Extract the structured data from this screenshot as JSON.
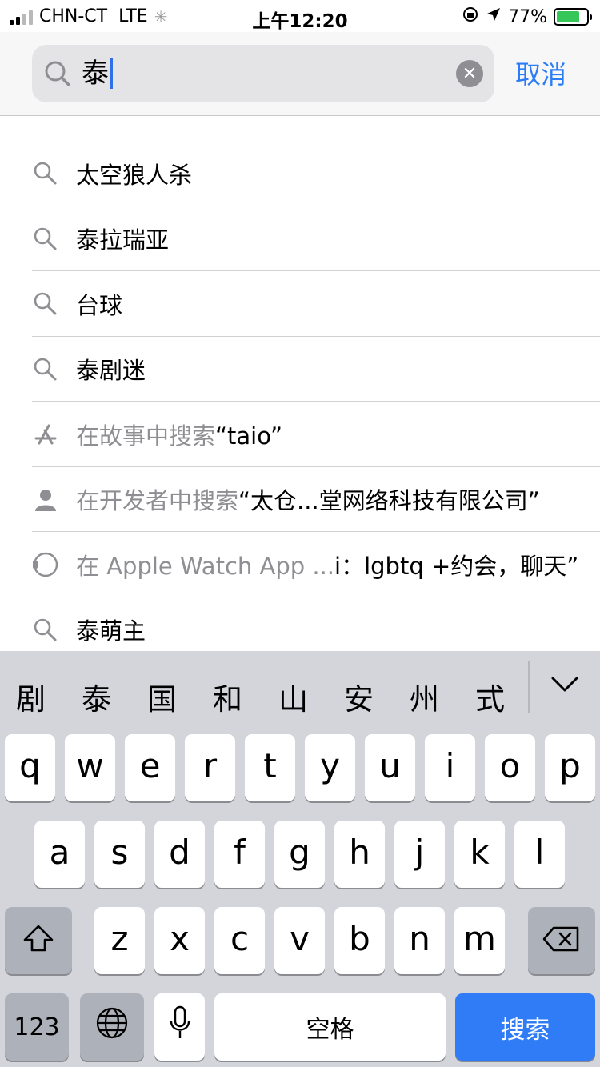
{
  "status_bar": {
    "carrier": "CHN-CT",
    "network": "LTE",
    "time": "上午12:20",
    "battery_percent": "77%",
    "battery_level": 0.77
  },
  "search": {
    "query": "泰",
    "cancel_label": "取消"
  },
  "suggestions": [
    {
      "type": "search",
      "icon": "search-icon",
      "prefix": "",
      "text": "太空狼人杀"
    },
    {
      "type": "search",
      "icon": "search-icon",
      "prefix": "",
      "text": "泰拉瑞亚"
    },
    {
      "type": "search",
      "icon": "search-icon",
      "prefix": "",
      "text": "台球"
    },
    {
      "type": "search",
      "icon": "search-icon",
      "prefix": "",
      "text": "泰剧迷"
    },
    {
      "type": "story",
      "icon": "app-store-icon",
      "prefix": "在故事中搜索",
      "text": "“taio”"
    },
    {
      "type": "developer",
      "icon": "person-icon",
      "prefix": "在开发者中搜索",
      "text": "“太仓...堂网络科技有限公司”"
    },
    {
      "type": "watch",
      "icon": "apple-watch-icon",
      "prefix": "在 Apple Watch App ...",
      "text": "i：lgbtq +约会，聊天”"
    },
    {
      "type": "search",
      "icon": "search-icon",
      "prefix": "",
      "text": "泰萌主"
    }
  ],
  "keyboard": {
    "candidates": [
      "剧",
      "泰",
      "国",
      "和",
      "山",
      "安",
      "州",
      "式"
    ],
    "row1": [
      "q",
      "w",
      "e",
      "r",
      "t",
      "y",
      "u",
      "i",
      "o",
      "p"
    ],
    "row2": [
      "a",
      "s",
      "d",
      "f",
      "g",
      "h",
      "j",
      "k",
      "l"
    ],
    "row3": [
      "z",
      "x",
      "c",
      "v",
      "b",
      "n",
      "m"
    ],
    "numbers_label": "123",
    "space_label": "空格",
    "search_label": "搜索"
  },
  "colors": {
    "accent": "#2c7cf6",
    "search_button": "#2f7cf6",
    "keyboard_bg": "#d3d5db"
  }
}
